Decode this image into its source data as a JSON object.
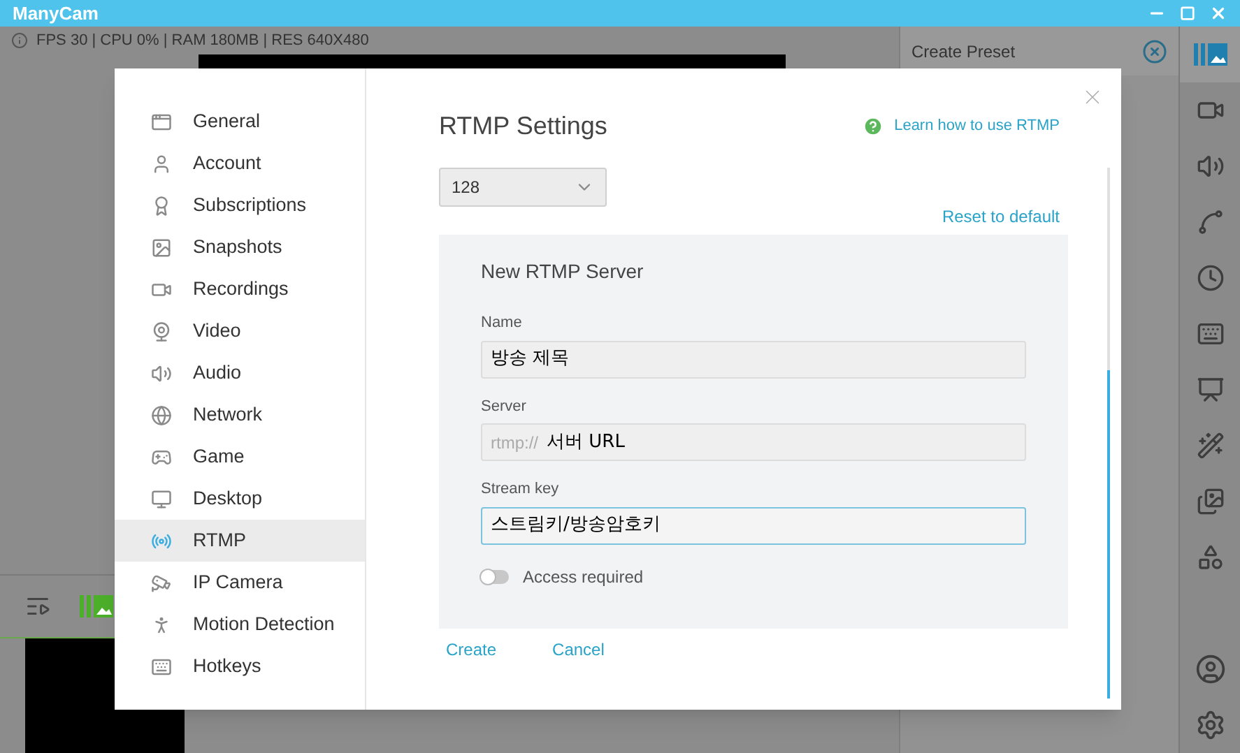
{
  "window": {
    "title": "ManyCam"
  },
  "status_bar": {
    "text": "FPS 30 | CPU 0% | RAM 180MB | RES 640X480"
  },
  "right_panel": {
    "title": "Create Preset"
  },
  "settings": {
    "sidebar": {
      "items": [
        {
          "label": "General",
          "selected": false
        },
        {
          "label": "Account",
          "selected": false
        },
        {
          "label": "Subscriptions",
          "selected": false
        },
        {
          "label": "Snapshots",
          "selected": false
        },
        {
          "label": "Recordings",
          "selected": false
        },
        {
          "label": "Video",
          "selected": false
        },
        {
          "label": "Audio",
          "selected": false
        },
        {
          "label": "Network",
          "selected": false
        },
        {
          "label": "Game",
          "selected": false
        },
        {
          "label": "Desktop",
          "selected": false
        },
        {
          "label": "RTMP",
          "selected": true
        },
        {
          "label": "IP Camera",
          "selected": false
        },
        {
          "label": "Motion Detection",
          "selected": false
        },
        {
          "label": "Hotkeys",
          "selected": false
        }
      ]
    },
    "title": "RTMP Settings",
    "help_link": "Learn how to use RTMP",
    "dropdown": {
      "value": "128"
    },
    "reset_link": "Reset to default",
    "server_form": {
      "title": "New RTMP Server",
      "fields": [
        {
          "label": "Name",
          "value": "방송 제목",
          "focused": false
        },
        {
          "label": "Server",
          "prefix": "rtmp://",
          "value": "서버 URL",
          "focused": false
        },
        {
          "label": "Stream key",
          "value": "스트림키/방송암호키",
          "focused": true
        }
      ],
      "toggle": {
        "label": "Access required",
        "on": false
      }
    },
    "buttons": [
      "Create",
      "Cancel"
    ]
  }
}
